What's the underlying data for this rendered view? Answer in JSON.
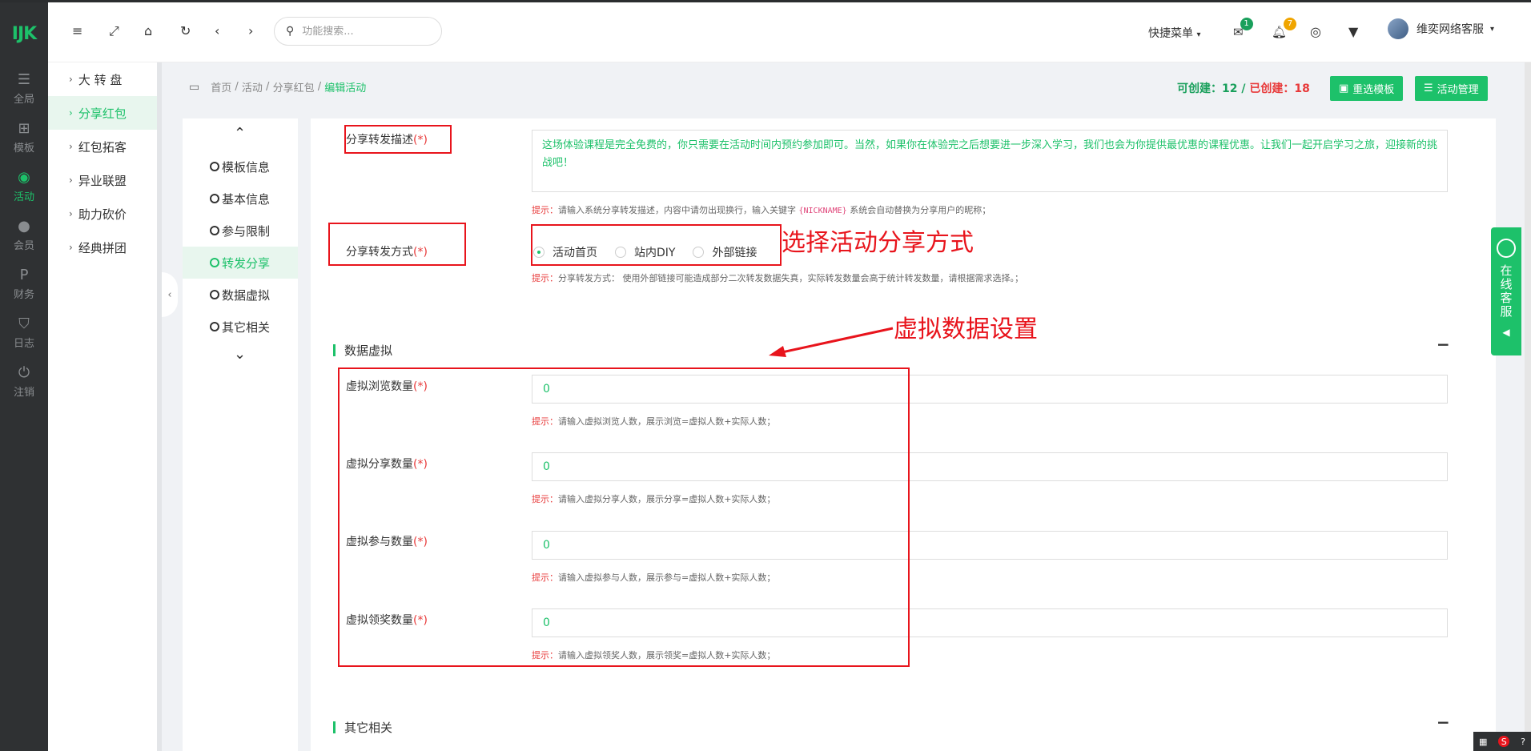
{
  "header": {
    "search_placeholder": "功能搜索...",
    "quick_menu": "快捷菜单",
    "mail_count": "1",
    "bell_count": "7",
    "user_name": "维奕网络客服"
  },
  "rail": {
    "logo": "IJK",
    "items": [
      {
        "label": "全局",
        "icon": "sliders-icon"
      },
      {
        "label": "模板",
        "icon": "sitemap-icon"
      },
      {
        "label": "活动",
        "icon": "location-icon"
      },
      {
        "label": "会员",
        "icon": "users-icon"
      },
      {
        "label": "财务",
        "icon": "paypal-icon"
      },
      {
        "label": "日志",
        "icon": "shield-icon"
      },
      {
        "label": "注销",
        "icon": "power-icon"
      }
    ]
  },
  "subnav": {
    "items": [
      "大 转 盘",
      "分享红包",
      "红包拓客",
      "异业联盟",
      "助力砍价",
      "经典拼团"
    ]
  },
  "breadcrumb": {
    "home": "首页",
    "l2": "活动",
    "l3": "分享红包",
    "current": "编辑活动"
  },
  "stats": {
    "can_create_label": "可创建：",
    "can_create_value": "12",
    "sep": " / ",
    "created_label": "已创建：",
    "created_value": "18"
  },
  "buttons": {
    "reselect_template": "重选模板",
    "activity_manage": "活动管理"
  },
  "anchors": [
    "模板信息",
    "基本信息",
    "参与限制",
    "转发分享",
    "数据虚拟",
    "其它相关"
  ],
  "form": {
    "share_desc_label": "分享转发描述",
    "required_mark": "(*)",
    "share_desc_value": "这场体验课程是完全免费的，你只需要在活动时间内预约参加即可。当然，如果你在体验完之后想要进一步深入学习，我们也会为你提供最优惠的课程优惠。让我们一起开启学习之旅，迎接新的挑战吧！",
    "hint_prefix": "提示：",
    "share_desc_hint_a": "请输入系统分享转发描述，内容中请勿出现换行，输入关键字",
    "share_desc_hint_code": "{NICKNAME}",
    "share_desc_hint_b": "系统会自动替换为分享用户的昵称；",
    "share_mode_label": "分享转发方式",
    "share_mode_options": [
      "活动首页",
      "站内DIY",
      "外部链接"
    ],
    "share_mode_selected": "活动首页",
    "share_mode_hint": "分享转发方式： 使用外部链接可能造成部分二次转发数据失真，实际转发数量会高于统计转发数量，请根据需求选择。；",
    "section_virtual": "数据虚拟",
    "virtual_fields": [
      {
        "label": "虚拟浏览数量",
        "value": "0",
        "hint": "请输入虚拟浏览人数，展示浏览=虚拟人数+实际人数；"
      },
      {
        "label": "虚拟分享数量",
        "value": "0",
        "hint": "请输入虚拟分享人数，展示分享=虚拟人数+实际人数；"
      },
      {
        "label": "虚拟参与数量",
        "value": "0",
        "hint": "请输入虚拟参与人数，展示参与=虚拟人数+实际人数；"
      },
      {
        "label": "虚拟领奖数量",
        "value": "0",
        "hint": "请输入虚拟领奖人数，展示领奖=虚拟人数+实际人数；"
      }
    ],
    "section_other": "其它相关"
  },
  "annotations": {
    "share_mode_note": "选择活动分享方式",
    "virtual_note": "虚拟数据设置"
  },
  "chat_float": {
    "label": "在线客服"
  },
  "colors": {
    "accent": "#1dc16a",
    "annotation_red": "#e8141c",
    "rail_bg": "#2f3133"
  }
}
